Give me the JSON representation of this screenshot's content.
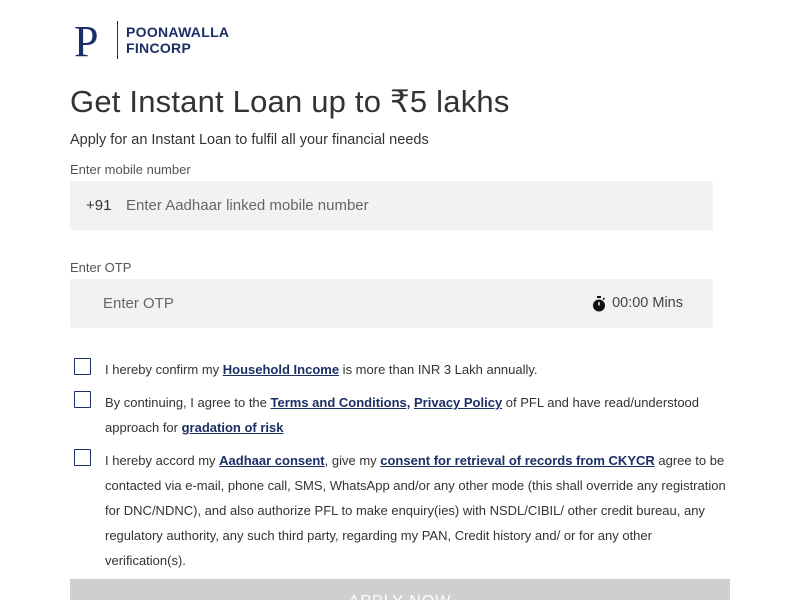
{
  "brand": {
    "name_line1": "POONAWALLA",
    "name_line2": "FINCORP",
    "logo_letter": "P",
    "color": "#1b2f66"
  },
  "hero": {
    "title": "Get Instant Loan up to ₹5 lakhs",
    "subtitle": "Apply for an Instant Loan to fulfil all your financial needs"
  },
  "mobile": {
    "label": "Enter mobile number",
    "prefix": "+91",
    "placeholder": "Enter Aadhaar linked mobile number",
    "value": ""
  },
  "otp": {
    "label": "Enter OTP",
    "placeholder": "Enter OTP",
    "value": "",
    "timer": "00:00 Mins",
    "timer_icon": "stopwatch-icon"
  },
  "consents": {
    "income": {
      "checked": false,
      "text_before": "I hereby confirm my ",
      "link": "Household Income",
      "text_after": " is more than INR 3 Lakh annually."
    },
    "terms": {
      "checked": false,
      "text_before": "By continuing, I agree to the ",
      "link_terms": "Terms and Conditions,",
      "text_mid": " ",
      "link_privacy": "Privacy Policy",
      "text_after": " of PFL and have read/understood approach for ",
      "link_risk": "gradation of risk"
    },
    "aadhaar": {
      "checked": false,
      "text_before": "I hereby accord my ",
      "link_aadhaar": "Aadhaar consent",
      "text_mid": ", give my ",
      "link_ckycr": "consent for retrieval of records from CKYCR",
      "text_after": " agree to be contacted via e-mail, phone call, SMS, WhatsApp and/or any other mode (this shall override any registration for DNC/NDNC), and also authorize PFL to make enquiry(ies) with NSDL/CIBIL/ other credit bureau, any regulatory authority, any such third party, regarding my PAN, Credit history and/ or for any other verification(s)."
    }
  },
  "apply_button": {
    "label": "APPLY NOW",
    "state": "disabled"
  }
}
